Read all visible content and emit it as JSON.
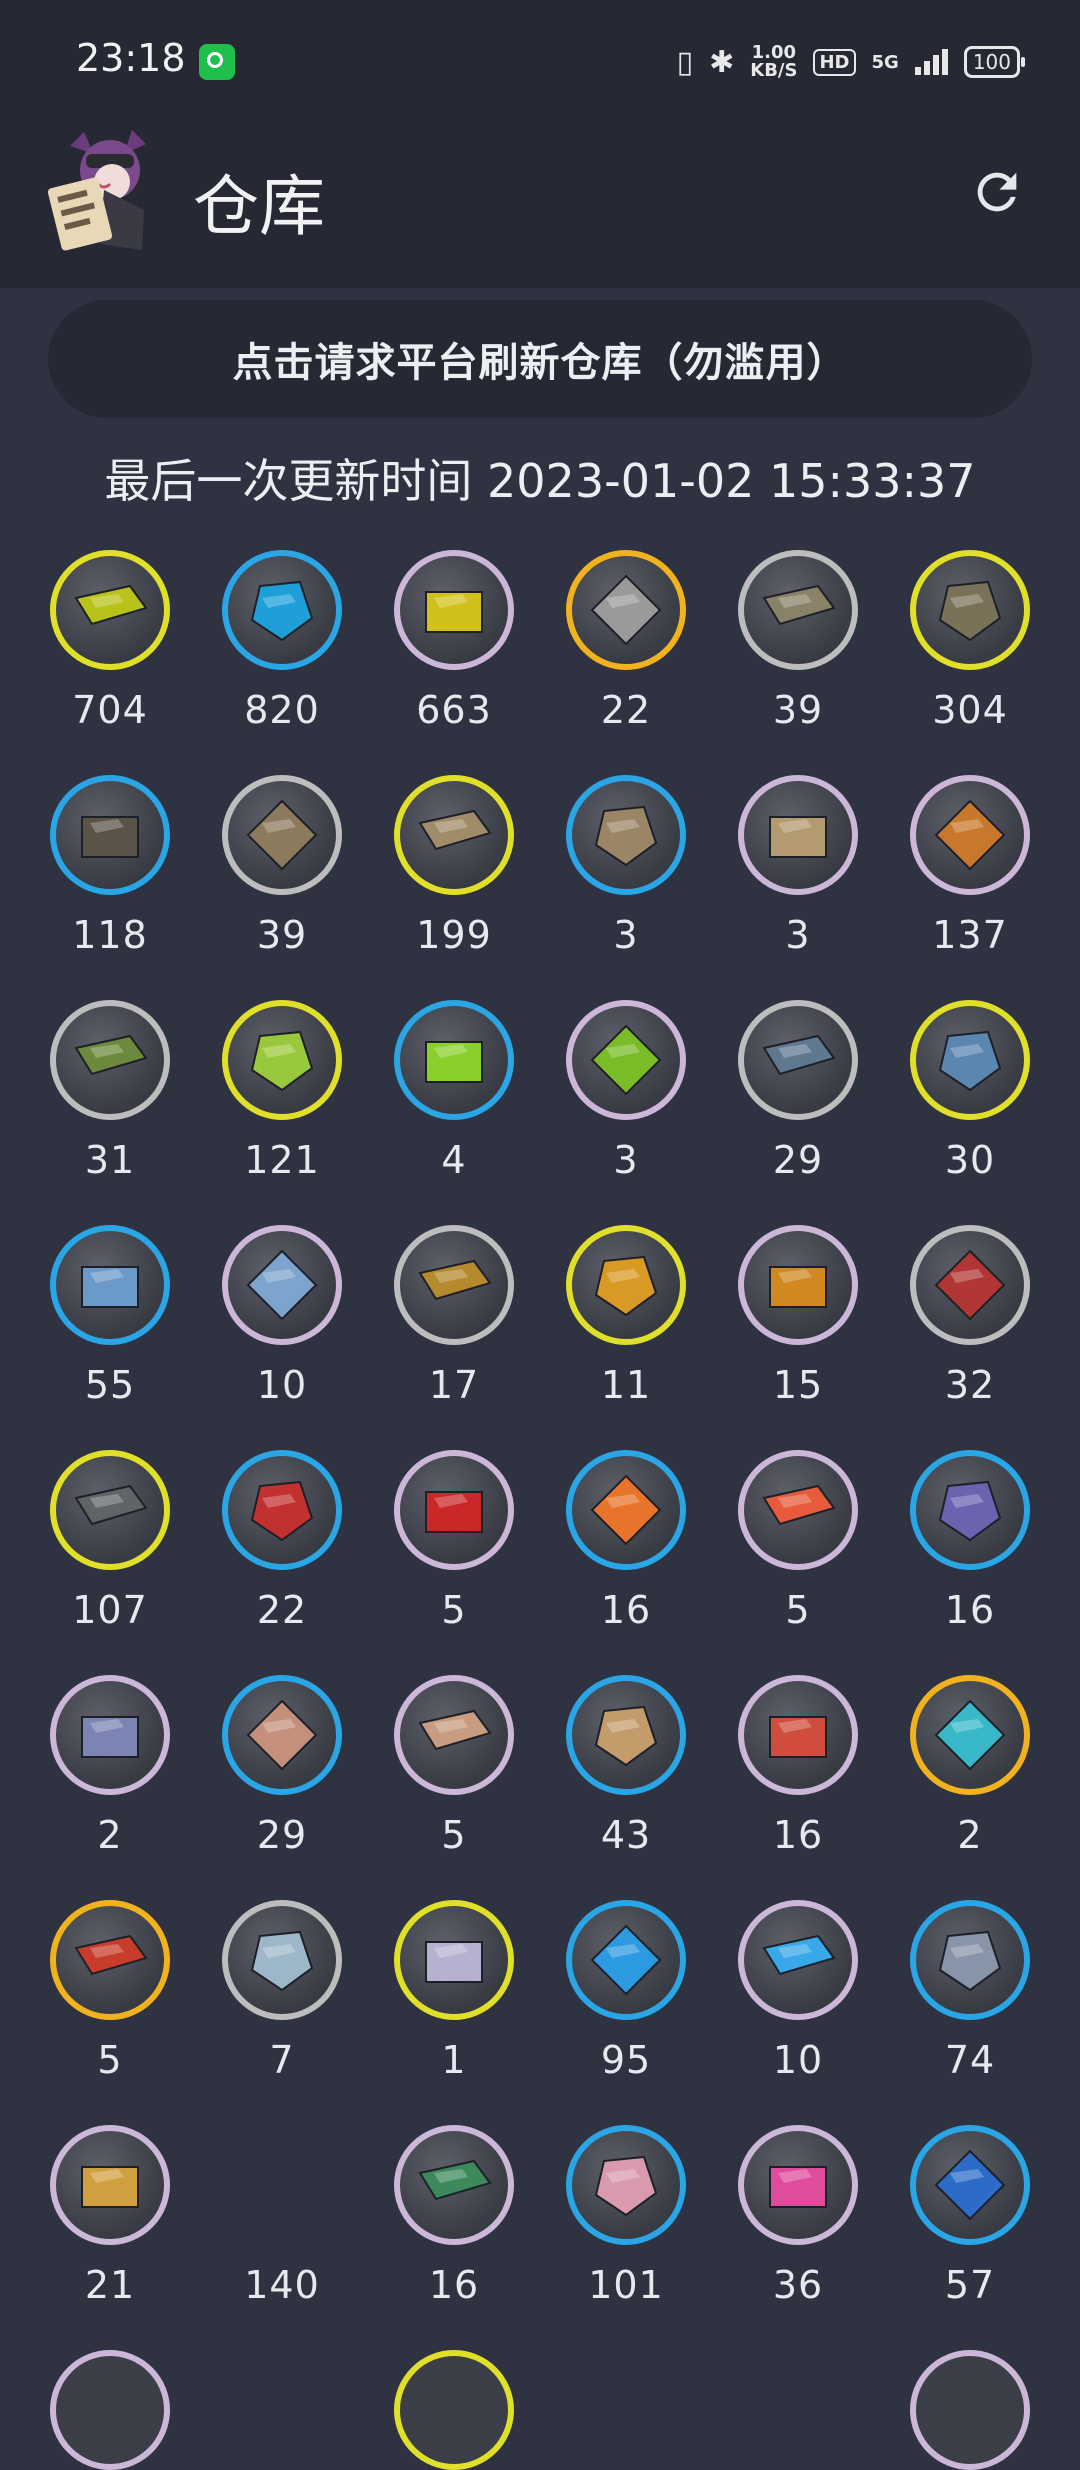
{
  "status_bar": {
    "time": "23:18",
    "net_speed_value": "1.00",
    "net_speed_unit": "KB/S",
    "hd_label": "HD",
    "signal_label": "5G",
    "battery_level": "100"
  },
  "app_bar": {
    "title": "仓库"
  },
  "request_button_label": "点击请求平台刷新仓库（勿滥用）",
  "last_updated_text": "最后一次更新时间 2023-01-02 15:33:37",
  "colors": {
    "background": "#2f3341",
    "bar_background": "#262934",
    "rarity_gray": "#bdbdbd",
    "rarity_purple": "#cdb7d9",
    "rarity_blue": "#2aa6e6",
    "rarity_yellow": "#e0df2a",
    "rarity_gold": "#f0b21e"
  },
  "items": [
    {
      "icon": "exp-record-green-icon",
      "rarity": "t5",
      "count": "704",
      "color": "#b8c21a"
    },
    {
      "icon": "exp-record-blue-icon",
      "rarity": "t4",
      "count": "820",
      "color": "#1e9fd8"
    },
    {
      "icon": "exp-record-yellow-icon",
      "rarity": "t3",
      "count": "663",
      "color": "#d2c01a"
    },
    {
      "icon": "exp-record-gray-icon",
      "rarity": "t6",
      "count": "22",
      "color": "#9a9a9a"
    },
    {
      "icon": "orirock-icon",
      "rarity": "t2",
      "count": "39",
      "color": "#8a8268"
    },
    {
      "icon": "orirock-cube-icon",
      "rarity": "t5",
      "count": "304",
      "color": "#7a7258"
    },
    {
      "icon": "orirock-cluster-icon",
      "rarity": "t4",
      "count": "118",
      "color": "#5a5448"
    },
    {
      "icon": "sugar-substitute-icon",
      "rarity": "t2",
      "count": "39",
      "color": "#8c7a5c"
    },
    {
      "icon": "sugar-icon",
      "rarity": "t5",
      "count": "199",
      "color": "#a08c68"
    },
    {
      "icon": "sugar-pack-icon",
      "rarity": "t4",
      "count": "3",
      "color": "#9a8664"
    },
    {
      "icon": "sugar-lump-icon",
      "rarity": "t3",
      "count": "3",
      "color": "#b49a70"
    },
    {
      "icon": "ester-icon",
      "rarity": "t3",
      "count": "137",
      "color": "#c8782c"
    },
    {
      "icon": "polyester-icon",
      "rarity": "t2",
      "count": "31",
      "color": "#6c8a3c"
    },
    {
      "icon": "polyester-pack-icon",
      "rarity": "t5",
      "count": "121",
      "color": "#9ac83c"
    },
    {
      "icon": "polyester-lump-icon",
      "rarity": "t4",
      "count": "4",
      "color": "#8ad02c"
    },
    {
      "icon": "polyester-case-icon",
      "rarity": "t3",
      "count": "3",
      "color": "#7abc28"
    },
    {
      "icon": "oriron-shard-icon",
      "rarity": "t2",
      "count": "29",
      "color": "#5e7890"
    },
    {
      "icon": "oriron-icon",
      "rarity": "t5",
      "count": "30",
      "color": "#5a86b0"
    },
    {
      "icon": "oriron-cluster-icon",
      "rarity": "t4",
      "count": "55",
      "color": "#6c9ac8"
    },
    {
      "icon": "oriron-block-icon",
      "rarity": "t3",
      "count": "10",
      "color": "#7ca4cc"
    },
    {
      "icon": "diketon-icon",
      "rarity": "t2",
      "count": "17",
      "color": "#b48a2c"
    },
    {
      "icon": "polyketon-icon",
      "rarity": "t5",
      "count": "11",
      "color": "#d89a24"
    },
    {
      "icon": "aketon-icon",
      "rarity": "t3",
      "count": "15",
      "color": "#d08820"
    },
    {
      "icon": "keton-colloid-icon",
      "rarity": "t2",
      "count": "32",
      "color": "#b23636"
    },
    {
      "icon": "damaged-device-icon",
      "rarity": "t5",
      "count": "107",
      "color": "#606466"
    },
    {
      "icon": "device-icon",
      "rarity": "t4",
      "count": "22",
      "color": "#c23030"
    },
    {
      "icon": "integrated-device-icon",
      "rarity": "t3",
      "count": "5",
      "color": "#c82828"
    },
    {
      "icon": "loxic-kohl-icon",
      "rarity": "t4",
      "count": "16",
      "color": "#e8742c"
    },
    {
      "icon": "white-horse-kohl-icon",
      "rarity": "t3",
      "count": "5",
      "color": "#e85a3c"
    },
    {
      "icon": "manganese-ore-icon",
      "rarity": "t4",
      "count": "16",
      "color": "#6a64b0"
    },
    {
      "icon": "manganese-trihydrate-icon",
      "rarity": "t3",
      "count": "2",
      "color": "#7c84b4"
    },
    {
      "icon": "grindstone-icon",
      "rarity": "t4",
      "count": "29",
      "color": "#c4907c"
    },
    {
      "icon": "grindstone-pentahydrate-icon",
      "rarity": "t3",
      "count": "5",
      "color": "#c89c80"
    },
    {
      "icon": "rma70-12-icon",
      "rarity": "t4",
      "count": "43",
      "color": "#c49c6c"
    },
    {
      "icon": "rma70-24-icon",
      "rarity": "t3",
      "count": "16",
      "color": "#d04c3c"
    },
    {
      "icon": "polymerized-gel-icon",
      "rarity": "t6",
      "count": "2",
      "color": "#38b8c8"
    },
    {
      "icon": "incandescent-alloy-icon",
      "rarity": "t6",
      "count": "5",
      "color": "#c83c2c"
    },
    {
      "icon": "crystalline-component-icon",
      "rarity": "t2",
      "count": "7",
      "color": "#9cb8c8"
    },
    {
      "icon": "crystalline-circuit-icon",
      "rarity": "t5",
      "count": "1",
      "color": "#b8b0d0"
    },
    {
      "icon": "semi-synthetic-solvent-icon",
      "rarity": "t4",
      "count": "95",
      "color": "#2c9ae0"
    },
    {
      "icon": "refined-solvent-icon",
      "rarity": "t3",
      "count": "10",
      "color": "#38a8e8"
    },
    {
      "icon": "compound-cutting-fluid-icon",
      "rarity": "t4",
      "count": "74",
      "color": "#8894a8"
    },
    {
      "icon": "cutting-fluid-solution-icon",
      "rarity": "t3",
      "count": "21",
      "color": "#d0a040"
    },
    {
      "icon": "transmuted-salt-icon",
      "rarity": "none",
      "count": "140",
      "color": "#2f3341"
    },
    {
      "icon": "crystal-electronic-unit-icon",
      "rarity": "t3",
      "count": "16",
      "color": "#3c8a5c"
    },
    {
      "icon": "chip-catalyst-icon",
      "rarity": "t4",
      "count": "101",
      "color": "#d89aac"
    },
    {
      "icon": "nucleic-crystal-sinter-icon",
      "rarity": "t3",
      "count": "36",
      "color": "#e04c9c"
    },
    {
      "icon": "fuscous-fiber-icon",
      "rarity": "t4",
      "count": "57",
      "color": "#2c6cc8"
    }
  ]
}
